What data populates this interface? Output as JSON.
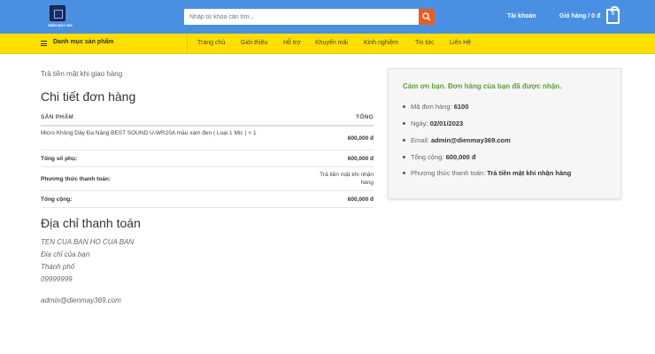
{
  "header": {
    "logo_text": "ĐIỆN MÁY 369",
    "search_placeholder": "Nhập từ khóa cần tìm...",
    "account": "Tài khoản",
    "cart": "Giỏ hàng / 0 đ",
    "cart_count": "0"
  },
  "nav": {
    "category": "Danh mục sản phẩm",
    "items": [
      "Trang chủ",
      "Giới thiệu",
      "Hỗ trợ",
      "Khuyến mãi",
      "Kinh nghiệm",
      "Tin tức",
      "Liên Hệ"
    ]
  },
  "order": {
    "payment_note": "Trả tiền mặt khi giao hàng",
    "title": "Chi tiết đơn hàng",
    "col_product": "SẢN PHẨM",
    "col_total": "TỔNG",
    "product_name": "Micro Không Dây Đa Năng BEST SOUND U-WR20A màu xám đen ( Loại 1 Mic )",
    "product_qty": "× 1",
    "product_total": "600,000 đ",
    "subtotal_label": "Tổng số phụ:",
    "subtotal_value": "600,000 đ",
    "payment_label": "Phương thức thanh toán:",
    "payment_value_1": "Trả tiền mặt khi nhận",
    "payment_value_2": "hàng",
    "total_label": "Tổng cộng:",
    "total_value": "600,000 đ"
  },
  "billing": {
    "title": "Địa chỉ thanh toán",
    "name": "TEN CUA BAN HO CUA BAN",
    "address": "Địa chỉ của bạn",
    "city": "Thành phố",
    "phone": "09999999",
    "email": "admin@dienmay369.com"
  },
  "summary": {
    "thanks": "Cám ơn bạn. Đơn hàng của bạn đã được nhận.",
    "order_no_label": "Mã đơn hàng:",
    "order_no": "6100",
    "date_label": "Ngày:",
    "date": "02/01/2023",
    "email_label": "Email:",
    "email": "admin@dienmay369.com",
    "total_label": "Tổng cộng:",
    "total": "600,000 đ",
    "method_label": "Phương thức thanh toán:",
    "method": "Trả tiền mặt khi nhận hàng"
  },
  "colors": {
    "header_blue": "#4a90e2",
    "nav_yellow": "#ffdf00",
    "search_orange": "#e85d26",
    "thanks_green": "#5a9e3a"
  }
}
